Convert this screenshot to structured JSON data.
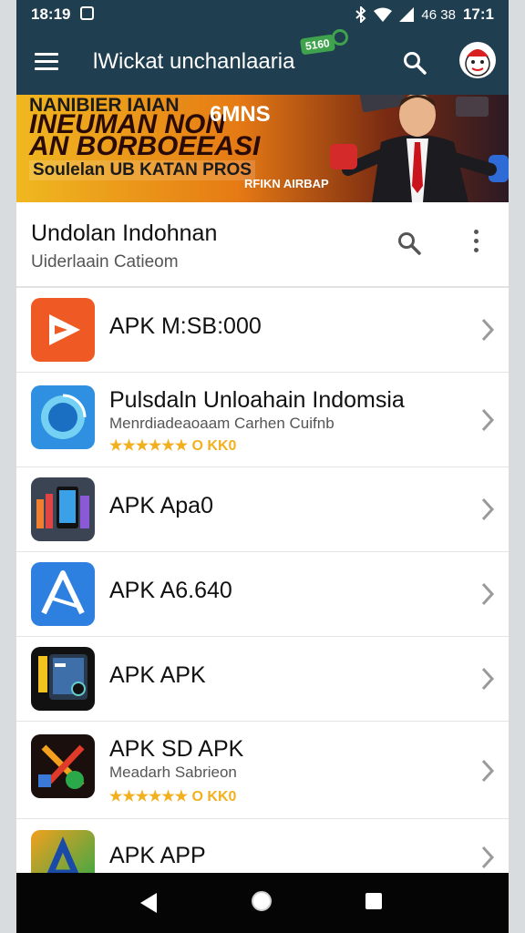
{
  "status_bar": {
    "time": "18:19",
    "right_text": "46 38",
    "right_time": "17:1"
  },
  "app_bar": {
    "title": "lWickat unchanlaaria",
    "badge": "5160"
  },
  "banner": {
    "line1": "NANIBIER IAIAN",
    "line2": "INEUMAN NON",
    "line2b": "6MNS",
    "line3": "AN BORBOEEASI",
    "line4": "Soulelan UB KATAN PROS",
    "line5": "RFIKN AIRBAP"
  },
  "section": {
    "title": "Undolan Indohnan",
    "subtitle": "Uiderlaain Catieom"
  },
  "apps": [
    {
      "name": "APK M:SB:000",
      "subtitle": "",
      "rating": ""
    },
    {
      "name": "Pulsdaln Unloahain Indomsia",
      "subtitle": "Menrdiadeaoaam Carhen Cuifnb",
      "rating": "★★★★★★ O KK0"
    },
    {
      "name": "APK Apa0",
      "subtitle": "",
      "rating": ""
    },
    {
      "name": "APK A6.640",
      "subtitle": "",
      "rating": ""
    },
    {
      "name": "APK APK",
      "subtitle": "",
      "rating": ""
    },
    {
      "name": "APK SD APK",
      "subtitle": "Meadarh Sabrieon",
      "rating": "★★★★★★ O KK0"
    },
    {
      "name": "APK APP",
      "subtitle": "",
      "rating": ""
    }
  ],
  "icons": {
    "menu": "menu-icon",
    "search": "search-icon",
    "more": "more-vert-icon",
    "chevron": "chevron-right-icon",
    "back": "back-icon",
    "home": "home-icon",
    "recent": "recent-apps-icon"
  },
  "colors": {
    "app_bar": "#1f3e4f",
    "accent_badge": "#3fa34d",
    "rating": "#f2b01e"
  }
}
